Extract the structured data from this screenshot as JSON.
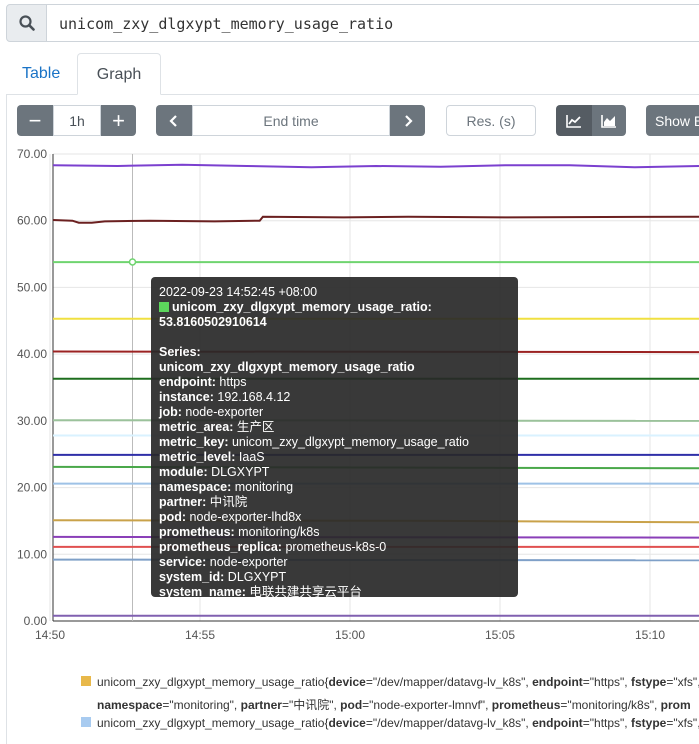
{
  "query": {
    "value": "unicom_zxy_dlgxypt_memory_usage_ratio"
  },
  "tabs": [
    {
      "label": "Table"
    },
    {
      "label": "Graph"
    }
  ],
  "controls": {
    "range_minus": "−",
    "range_value": "1h",
    "range_plus": "+",
    "end_time_placeholder": "End time",
    "resolution_placeholder": "Res. (s)",
    "show_exemplars": "Show E"
  },
  "chart_data": {
    "type": "line",
    "y_ticks": [
      "70.00",
      "60.00",
      "50.00",
      "40.00",
      "30.00",
      "20.00",
      "10.00",
      "0.00"
    ],
    "x_ticks": [
      "14:50",
      "14:55",
      "15:00",
      "15:05",
      "15:10"
    ],
    "ylim": [
      0,
      70
    ],
    "x_range": [
      "14:50",
      "15:11"
    ],
    "grid": true,
    "hover_time": "14:52:45",
    "series": [
      {
        "color": "#7b40cf",
        "points": [
          [
            0,
            68.3
          ],
          [
            10,
            68.2
          ],
          [
            20,
            68.4
          ],
          [
            30,
            68.2
          ],
          [
            40,
            68.0
          ],
          [
            50,
            68.2
          ],
          [
            60,
            68.1
          ],
          [
            70,
            68.3
          ],
          [
            80,
            68.3
          ],
          [
            90,
            68.0
          ],
          [
            100,
            68.2
          ]
        ]
      },
      {
        "color": "#6b2020",
        "points": [
          [
            0,
            60.1
          ],
          [
            3,
            60.0
          ],
          [
            4,
            59.7
          ],
          [
            6,
            59.7
          ],
          [
            8,
            59.9
          ],
          [
            15,
            60.0
          ],
          [
            25,
            59.9
          ],
          [
            32,
            60.0
          ],
          [
            32.5,
            60.6
          ],
          [
            45,
            60.5
          ],
          [
            55,
            60.6
          ],
          [
            70,
            60.5
          ],
          [
            100,
            60.6
          ]
        ]
      },
      {
        "color": "#6fd46f",
        "points": [
          [
            0,
            53.8
          ],
          [
            100,
            53.8
          ]
        ]
      },
      {
        "color": "#f0e040",
        "points": [
          [
            0,
            45.3
          ],
          [
            100,
            45.3
          ]
        ]
      },
      {
        "color": "#9b2222",
        "points": [
          [
            0,
            40.4
          ],
          [
            100,
            40.3
          ]
        ]
      },
      {
        "color": "#1e6e1e",
        "points": [
          [
            0,
            36.3
          ],
          [
            100,
            36.3
          ]
        ]
      },
      {
        "color": "#9bc29b",
        "points": [
          [
            0,
            30.1
          ],
          [
            100,
            30.0
          ]
        ]
      },
      {
        "color": "#d9f2ff",
        "points": [
          [
            0,
            27.8
          ],
          [
            100,
            27.8
          ]
        ]
      },
      {
        "color": "#2f2fa8",
        "points": [
          [
            0,
            24.9
          ],
          [
            100,
            24.9
          ]
        ]
      },
      {
        "color": "#4aa84a",
        "points": [
          [
            0,
            23.1
          ],
          [
            100,
            22.9
          ]
        ]
      },
      {
        "color": "#9ec2e6",
        "points": [
          [
            0,
            20.6
          ],
          [
            100,
            20.6
          ]
        ]
      },
      {
        "color": "#c9a24a",
        "points": [
          [
            0,
            15.1
          ],
          [
            60,
            15.0
          ],
          [
            100,
            14.8
          ]
        ]
      },
      {
        "color": "#8a3fb8",
        "points": [
          [
            0,
            12.6
          ],
          [
            100,
            12.5
          ]
        ]
      },
      {
        "color": "#e05050",
        "points": [
          [
            0,
            11.1
          ],
          [
            100,
            11.1
          ]
        ]
      },
      {
        "color": "#7fa0c8",
        "points": [
          [
            0,
            9.2
          ],
          [
            100,
            9.1
          ]
        ]
      },
      {
        "color": "#8060b0",
        "points": [
          [
            0,
            0.8
          ],
          [
            100,
            0.8
          ]
        ]
      }
    ]
  },
  "tooltip": {
    "timestamp": "2022-09-23 14:52:45 +08:00",
    "swatch_color": "#5cd65c",
    "value_line": "unicom_zxy_dlgxypt_memory_usage_ratio: 53.8160502910614",
    "series_heading": "Series:",
    "metric_name": "unicom_zxy_dlgxypt_memory_usage_ratio",
    "labels": [
      {
        "key": "endpoint",
        "value": "https"
      },
      {
        "key": "instance",
        "value": "192.168.4.12"
      },
      {
        "key": "job",
        "value": "node-exporter"
      },
      {
        "key": "metric_area",
        "value": "生产区"
      },
      {
        "key": "metric_key",
        "value": "unicom_zxy_dlgxypt_memory_usage_ratio"
      },
      {
        "key": "metric_level",
        "value": "IaaS"
      },
      {
        "key": "module",
        "value": "DLGXYPT"
      },
      {
        "key": "namespace",
        "value": "monitoring"
      },
      {
        "key": "partner",
        "value": "中讯院"
      },
      {
        "key": "pod",
        "value": "node-exporter-lhd8x"
      },
      {
        "key": "prometheus",
        "value": "monitoring/k8s"
      },
      {
        "key": "prometheus_replica",
        "value": "prometheus-k8s-0"
      },
      {
        "key": "service",
        "value": "node-exporter"
      },
      {
        "key": "system_id",
        "value": "DLGXYPT"
      },
      {
        "key": "system_name",
        "value": "电联共建共享云平台"
      }
    ]
  },
  "legend": {
    "items": [
      {
        "color": "#e8b84a",
        "metric": "unicom_zxy_dlgxypt_memory_usage_ratio{",
        "line1": [
          {
            "k": "device",
            "v": "\"/dev/mapper/datavg-lv_k8s\", "
          },
          {
            "k": "endpoint",
            "v": "\"https\", "
          },
          {
            "k": "fstype",
            "v": "\"xfs\", "
          }
        ],
        "line2": [
          {
            "k": "namespace",
            "v": "\"monitoring\", "
          },
          {
            "k": "partner",
            "v": "\"中讯院\", "
          },
          {
            "k": "pod",
            "v": "\"node-exporter-lmnvf\", "
          },
          {
            "k": "prometheus",
            "v": "\"monitoring/k8s\", "
          },
          {
            "k": "prom",
            "v": ""
          }
        ]
      },
      {
        "color": "#a8cbf0",
        "metric": "unicom_zxy_dlgxypt_memory_usage_ratio{",
        "line1": [
          {
            "k": "device",
            "v": "\"/dev/mapper/datavg-lv_k8s\", "
          },
          {
            "k": "endpoint",
            "v": "\"https\", "
          },
          {
            "k": "fstype",
            "v": "\"xfs\", "
          }
        ]
      }
    ]
  }
}
